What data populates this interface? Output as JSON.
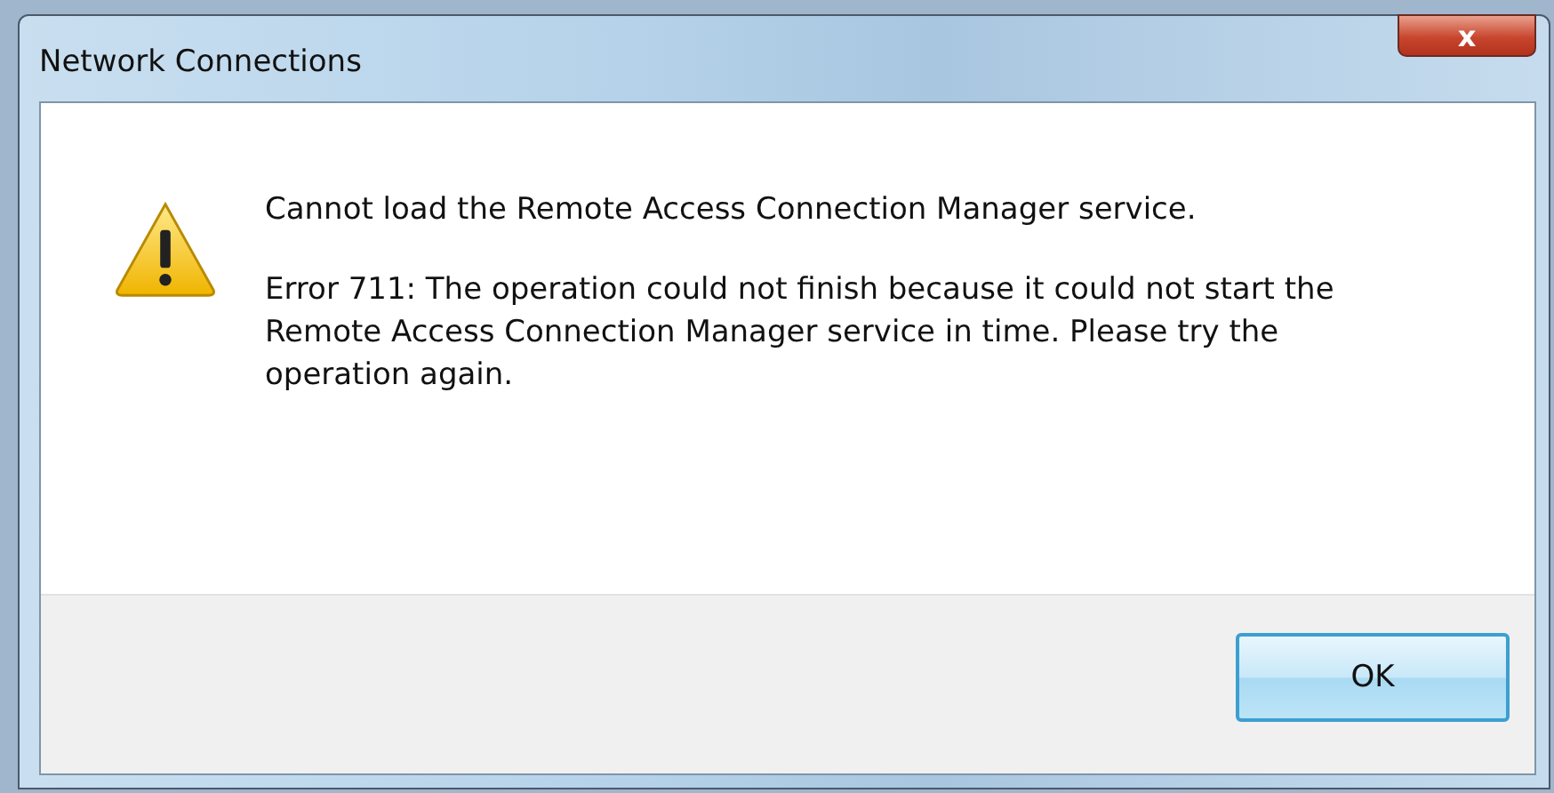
{
  "window": {
    "title": "Network Connections",
    "close": "x"
  },
  "message": {
    "heading": "Cannot load the Remote Access Connection Manager service.",
    "detail": "Error 711: The operation could not finish because it could not start the Remote Access Connection Manager service in time. Please try the operation again."
  },
  "buttons": [
    {
      "label": "OK",
      "focused": true
    }
  ]
}
